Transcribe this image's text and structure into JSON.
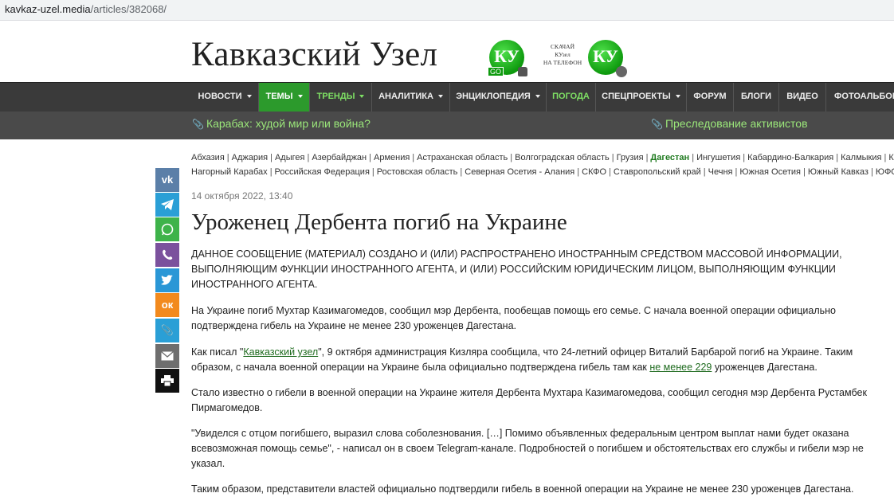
{
  "browser": {
    "url_host": "kavkaz-uzel.media",
    "url_path": "/articles/382068/"
  },
  "header": {
    "site_title": "Кавказский Узел",
    "app_text_line1": "СКАЧАЙ",
    "app_text_line2": "КУзел",
    "app_text_line3": "НА ТЕЛЕФОН",
    "badge_letters": "КУ",
    "go_label": "GO"
  },
  "nav": {
    "items": [
      {
        "label": "НОВОСТИ"
      },
      {
        "label": "ТЕМЫ"
      },
      {
        "label": "ТРЕНДЫ"
      },
      {
        "label": "АНАЛИТИКА"
      },
      {
        "label": "ЭНЦИКЛОПЕДИЯ"
      },
      {
        "label": "ПОГОДА"
      },
      {
        "label": "СПЕЦПРОЕКТЫ"
      },
      {
        "label": "ФОРУМ"
      },
      {
        "label": "БЛОГИ"
      },
      {
        "label": "ВИДЕО"
      },
      {
        "label": "ФОТОАЛЬБОМ"
      }
    ]
  },
  "subnav": {
    "link1": "Карабах: худой мир или война?",
    "link2": "Преследование активистов"
  },
  "regions": {
    "row1": [
      "Абхазия",
      "Аджария",
      "Адыгея",
      "Азербайджан",
      "Армения",
      "Астраханская область",
      "Волгоградская область",
      "Грузия",
      "Дагестан",
      "Ингушетия",
      "Кабардино-Балкария",
      "Калмыкия",
      "К"
    ],
    "row2": [
      "Нагорный Карабах",
      "Российская Федерация",
      "Ростовская область",
      "Северная Осетия - Алания",
      "СКФО",
      "Ставропольский край",
      "Чечня",
      "Южная Осетия",
      "Южный Кавказ",
      "ЮФО"
    ]
  },
  "share": {
    "vk": "vk",
    "ok": "ок"
  },
  "article": {
    "date": "14 октября 2022, 13:40",
    "title": "Уроженец Дербента погиб на Украине",
    "notice": "ДАННОЕ СООБЩЕНИЕ (МАТЕРИАЛ) СОЗДАНО И (ИЛИ) РАСПРОСТРАНЕНО ИНОСТРАННЫМ СРЕДСТВОМ МАССОВОЙ ИНФОРМАЦИИ, ВЫПОЛНЯЮЩИМ ФУНКЦИИ ИНОСТРАННОГО АГЕНТА, И (ИЛИ) РОССИЙСКИМ ЮРИДИЧЕСКИМ ЛИЦОМ, ВЫПОЛНЯЮЩИМ ФУНКЦИИ ИНОСТРАННОГО АГЕНТА.",
    "p1": "На Украине погиб Мухтар Казимагомедов, сообщил мэр Дербента, пообещав помощь его семье. С начала военной операции официально подтверждена гибель на Украине не менее 230 уроженцев Дагестана.",
    "p2_a": "Как писал \"",
    "p2_link": "Кавказский узел",
    "p2_b": "\", 9 октября администрация Кизляра сообщила, что 24-летний офицер Виталий Барбарой погиб на Украине. Таким образом, с начала военной операции на Украине была официально подтверждена гибель там как ",
    "p2_link2": "не менее 229",
    "p2_c": " уроженцев Дагестана.",
    "p3": "Стало известно о гибели в военной операции на Украине жителя Дербента Мухтара Казимагомедова, сообщил сегодня мэр Дербента Рустамбек Пирмагомедов.",
    "p4": "\"Увиделся с отцом погибшего, выразил слова соболезнования. […] Помимо объявленных федеральным центром выплат нами будет оказана всевозможная помощь семье\", - написал он в своем Telegram-канале. Подробностей о погибшем и обстоятельствах его службы и гибели мэр не указал.",
    "p5": "Таким образом, представители властей официально подтвердили гибель в военной операции на Украине не менее 230 уроженцев Дагестана."
  },
  "colors": {
    "nav_bg": "#3a3a3a",
    "nav_active": "#2c9a2c",
    "accent_green": "#7ee064",
    "link_green": "#1f6b1f"
  }
}
